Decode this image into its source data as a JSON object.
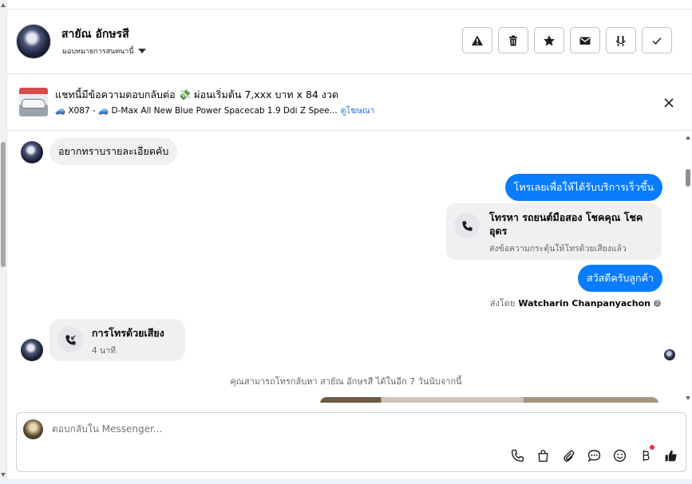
{
  "header": {
    "name": "สายัณ อักษรสี",
    "subtitle": "มอบหมายการสนทนานี้",
    "actions": [
      {
        "name": "report-button",
        "icon": "warning-icon"
      },
      {
        "name": "delete-button",
        "icon": "trash-icon"
      },
      {
        "name": "star-button",
        "icon": "star-icon"
      },
      {
        "name": "mark-unread-button",
        "icon": "envelope-icon"
      },
      {
        "name": "follow-up-button",
        "icon": "priority-icon"
      },
      {
        "name": "mark-done-button",
        "icon": "check-icon"
      }
    ]
  },
  "ad": {
    "title": "แชทนี้มีข้อความตอบกลับต่อ 💸 ผ่อนเริ่มต้น 7,xxx บาท x 84 งวด",
    "subtitle": "🚙 X087 - 🚙 D-Max All New Blue Power Spacecab 1.9 Ddi Z Spee...",
    "link": "ดูโฆษณา"
  },
  "messages": {
    "incoming_1": "อยากทราบรายละเอียดคับ",
    "outgoing_1": "โทรเลยเพื่อให้ได้รับบริการเร็วขึ้น",
    "call_request": {
      "title": "โทรหา รถยนต์มือสอง โชคคุณ โชค อุดร",
      "subtitle": "ส่งข้อความกระตุ้นให้โทรด้วยเสียงแล้ว"
    },
    "outgoing_2": "สวัสดีครับลูกค้า",
    "sent_by_prefix": "ส่งโดย",
    "sent_by_name": "Watcharin Chanpanyachon",
    "voice_call": {
      "title": "การโทรด้วยเสียง",
      "duration": "4 นาที"
    },
    "notice": "คุณสามารถโทรกลับหา สายัณ อักษรสี ได้ในอีก 7 วันนับจากนี้"
  },
  "composer": {
    "placeholder": "ตอบกลับใน Messenger...",
    "tools": [
      "phone-icon",
      "bag-icon",
      "attachment-icon",
      "reply-template-icon",
      "emoji-icon",
      "payment-icon",
      "thumbs-up-icon"
    ]
  }
}
